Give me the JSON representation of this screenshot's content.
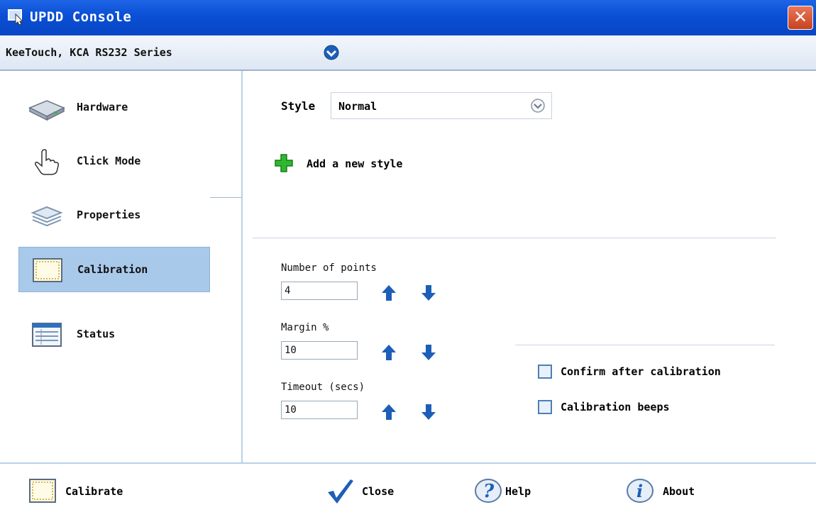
{
  "window": {
    "title": "UPDD Console",
    "close_glyph": "✕"
  },
  "device": {
    "name": "KeeTouch, KCA RS232 Series"
  },
  "sidebar": {
    "items": [
      {
        "label": "Hardware",
        "icon": "hardware-icon"
      },
      {
        "label": "Click Mode",
        "icon": "hand-pointer-icon"
      },
      {
        "label": "Properties",
        "icon": "layers-icon"
      },
      {
        "label": "Calibration",
        "icon": "calibration-icon"
      },
      {
        "label": "Status",
        "icon": "status-icon"
      }
    ],
    "active": "Calibration"
  },
  "style_section": {
    "label": "Style",
    "selected": "Normal",
    "add_label": "Add a new style"
  },
  "calibration": {
    "points": {
      "label": "Number of points",
      "value": "4"
    },
    "margin": {
      "label": "Margin %",
      "value": "10"
    },
    "timeout": {
      "label": "Timeout (secs)",
      "value": "10"
    },
    "confirm": {
      "label": "Confirm after calibration",
      "checked": false
    },
    "beeps": {
      "label": "Calibration beeps",
      "checked": false
    }
  },
  "footer": {
    "calibrate": "Calibrate",
    "close": "Close",
    "help": "Help",
    "about": "About"
  },
  "colors": {
    "title_bar": "#0a4fd4",
    "active_nav": "#a9c9ea",
    "arrow_blue": "#1d5fb8",
    "add_green": "#2fb82f"
  }
}
